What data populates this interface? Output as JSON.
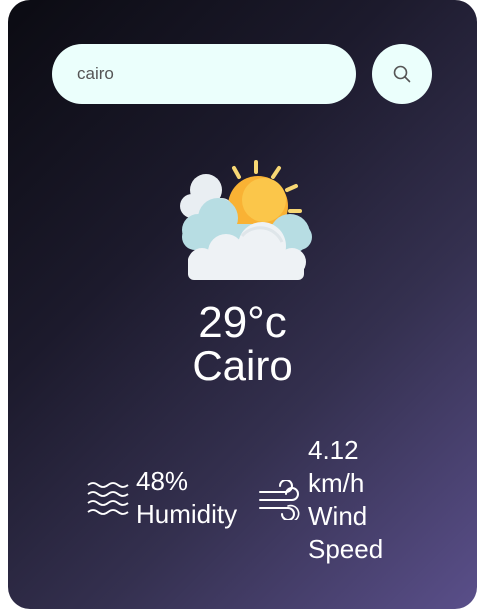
{
  "search": {
    "value": "cairo",
    "placeholder": ""
  },
  "icons": {
    "search": "search-icon",
    "weather": "partly-cloudy-icon",
    "humidity": "humidity-waves-icon",
    "wind": "wind-icon"
  },
  "weather": {
    "temperature": "29°c",
    "city": "Cairo"
  },
  "humidity": {
    "value": "48%",
    "label": "Humidity"
  },
  "wind": {
    "value_line1": "4.12",
    "value_line2": "km/h",
    "label_line1": "Wind",
    "label_line2": "Speed"
  },
  "colors": {
    "card_gradient_start": "#0b0b12",
    "card_gradient_end": "#5a4f8a",
    "input_background": "#ebfffc",
    "text": "#ffffff"
  }
}
